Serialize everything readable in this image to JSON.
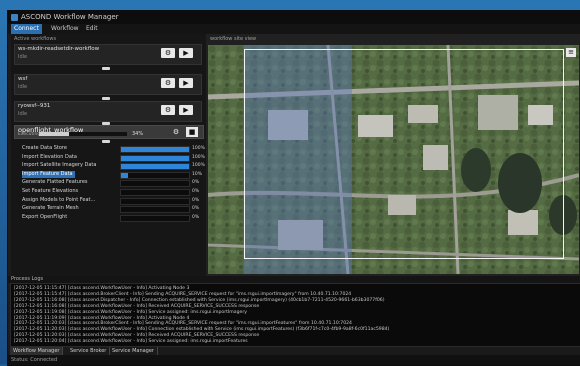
{
  "app": {
    "title": "ASCOND Workflow Manager"
  },
  "menu": {
    "connect": "Connect",
    "workflow": "Workflow",
    "edit": "Edit"
  },
  "left": {
    "header": "Active workflows",
    "workflows": [
      {
        "name": "ws-mkdir-readsetdir-workflow",
        "status": "Idle"
      },
      {
        "name": "wsf",
        "status": "Idle"
      },
      {
        "name": "ryowsf--931",
        "status": "Idle"
      }
    ],
    "active": {
      "name": "openflight_workflow",
      "status": "Executing",
      "progress_percent": 34,
      "progress_label": "34%"
    }
  },
  "tasks": [
    {
      "label": "Create Data Store",
      "percent": 100,
      "value": "100%"
    },
    {
      "label": "Import Elevation Data",
      "percent": 100,
      "value": "100%"
    },
    {
      "label": "Import Satellite Imagery Data",
      "percent": 100,
      "value": "100%"
    },
    {
      "label": "Import Feature Data",
      "percent": 10,
      "value": "10%"
    },
    {
      "label": "Generate Flatted Features",
      "percent": 0,
      "value": "0%"
    },
    {
      "label": "Set Feature Elevations",
      "percent": 0,
      "value": "0%"
    },
    {
      "label": "Assign Models to Point Feat...",
      "percent": 0,
      "value": "0%"
    },
    {
      "label": "Generate Terrain Mesh",
      "percent": 0,
      "value": "0%"
    },
    {
      "label": "Export OpenFlight",
      "percent": 0,
      "value": "0%"
    }
  ],
  "map": {
    "header": "workflow site view",
    "tool_icon": "layers-icon"
  },
  "log": {
    "title": "Process Logs",
    "lines": [
      "[2017-12-05 11:15:47] [class ascend.WorkflowUser - Info] Activating Node 3",
      "[2017-12-05 11:15:47] [class ascend.BrokerClient - Info] Sending ACQUIRE_SERVICE request for \"ims.rsgui.importImagery\" from 10.40.71.10:7024",
      "[2017-12-05 11:16:08] [class ascend.Dispatcher - Info] Connection established with Service (ims.rsgui.importImagery) (40cb1b7-7211-4520-9661-b63b3077f06)",
      "[2017-12-05 11:16:08] [class ascend.WorkflowUser - Info] Received ACQUIRE_SERVICE_SUCCESS response",
      "[2017-12-05 11:19:08] [class ascend.WorkflowUser - Info] Service assigned: ims.rsgui.importImagery",
      "[2017-12-05 11:19:09] [class ascend.WorkflowUser - Info] Activating Node 4",
      "[2017-12-05 11:20:03] [class ascend.BrokerClient - Info] Sending ACQUIRE_SERVICE request for \"ims.rsgui.importFeatures\" from 10.40.71.10:7024",
      "[2017-12-05 11:20:03] [class ascend.WorkflowUser - Info] Connection established with Service (ims.rsgui.importFeatures) (f3b6f71f-c7c0-4fb9-9a8f-6c0f11ac5984)",
      "[2017-12-05 11:20:03] [class ascend.WorkflowUser - Info] Received ACQUIRE_SERVICE_SUCCESS response",
      "[2017-12-05 11:20:04] [class ascend.WorkflowUser - Info] Service assigned: ims.rsgui.importFeatures"
    ]
  },
  "tabs": [
    "Workflow Manager",
    "Service Broker",
    "Service Manager"
  ],
  "status": "Status: Connected"
}
